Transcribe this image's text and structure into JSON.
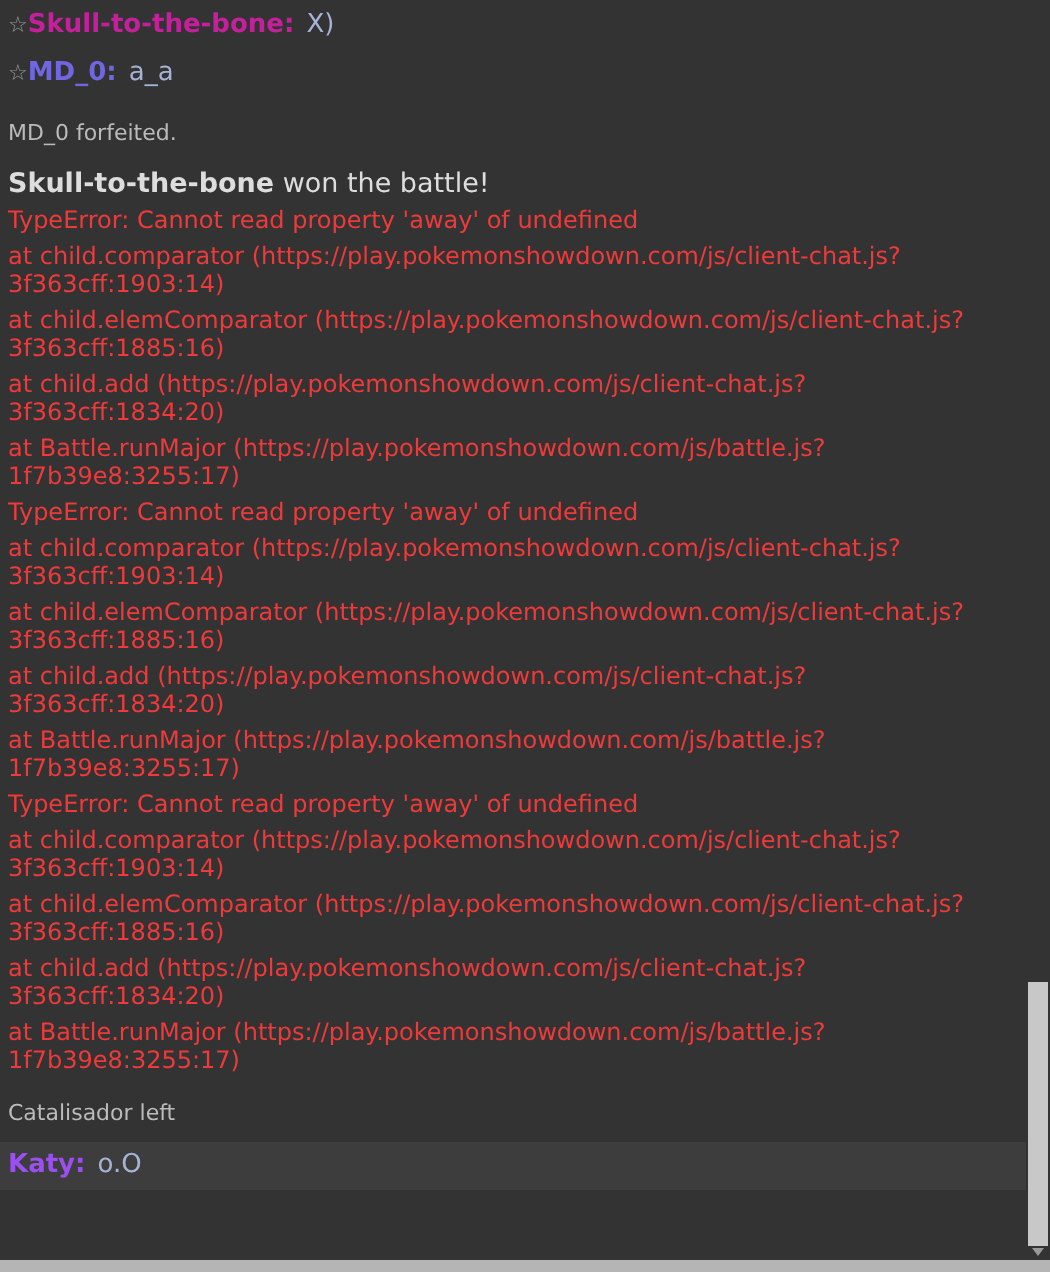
{
  "messages": [
    {
      "kind": "chat",
      "rank": "☆",
      "name": "Skull-to-the-bone:",
      "color": "#c5209c",
      "text": "X)"
    },
    {
      "kind": "chat",
      "rank": "☆",
      "name": "MD_0:",
      "color": "#6f66e0",
      "text": "a_a"
    },
    {
      "kind": "notice",
      "text": "MD_0 forfeited."
    },
    {
      "kind": "win",
      "winner": "Skull-to-the-bone",
      "text": "won the battle!"
    },
    {
      "kind": "error",
      "lines": [
        "TypeError: Cannot read property 'away' of undefined"
      ]
    },
    {
      "kind": "error",
      "lines": [
        "at child.comparator (https://play.pokemonshowdown.com/js/client-chat.js?",
        "3f363cff:1903:14)"
      ]
    },
    {
      "kind": "error",
      "lines": [
        "at child.elemComparator (https://play.pokemonshowdown.com/js/client-chat.js?",
        "3f363cff:1885:16)"
      ]
    },
    {
      "kind": "error",
      "lines": [
        "at child.add (https://play.pokemonshowdown.com/js/client-chat.js?",
        "3f363cff:1834:20)"
      ]
    },
    {
      "kind": "error",
      "lines": [
        "at Battle.runMajor (https://play.pokemonshowdown.com/js/battle.js?",
        "1f7b39e8:3255:17)"
      ]
    },
    {
      "kind": "error",
      "lines": [
        "TypeError: Cannot read property 'away' of undefined"
      ]
    },
    {
      "kind": "error",
      "lines": [
        "at child.comparator (https://play.pokemonshowdown.com/js/client-chat.js?",
        "3f363cff:1903:14)"
      ]
    },
    {
      "kind": "error",
      "lines": [
        "at child.elemComparator (https://play.pokemonshowdown.com/js/client-chat.js?",
        "3f363cff:1885:16)"
      ]
    },
    {
      "kind": "error",
      "lines": [
        "at child.add (https://play.pokemonshowdown.com/js/client-chat.js?",
        "3f363cff:1834:20)"
      ]
    },
    {
      "kind": "error",
      "lines": [
        "at Battle.runMajor (https://play.pokemonshowdown.com/js/battle.js?",
        "1f7b39e8:3255:17)"
      ]
    },
    {
      "kind": "error",
      "lines": [
        "TypeError: Cannot read property 'away' of undefined"
      ]
    },
    {
      "kind": "error",
      "lines": [
        "at child.comparator (https://play.pokemonshowdown.com/js/client-chat.js?",
        "3f363cff:1903:14)"
      ]
    },
    {
      "kind": "error",
      "lines": [
        "at child.elemComparator (https://play.pokemonshowdown.com/js/client-chat.js?",
        "3f363cff:1885:16)"
      ]
    },
    {
      "kind": "error",
      "lines": [
        "at child.add (https://play.pokemonshowdown.com/js/client-chat.js?",
        "3f363cff:1834:20)"
      ]
    },
    {
      "kind": "error",
      "lines": [
        "at Battle.runMajor (https://play.pokemonshowdown.com/js/battle.js?",
        "1f7b39e8:3255:17)"
      ]
    },
    {
      "kind": "notice",
      "text": "Catalisador left"
    },
    {
      "kind": "highlighted_chat",
      "name": "Katy:",
      "color": "#9b4ff0",
      "text": "o.O"
    }
  ]
}
